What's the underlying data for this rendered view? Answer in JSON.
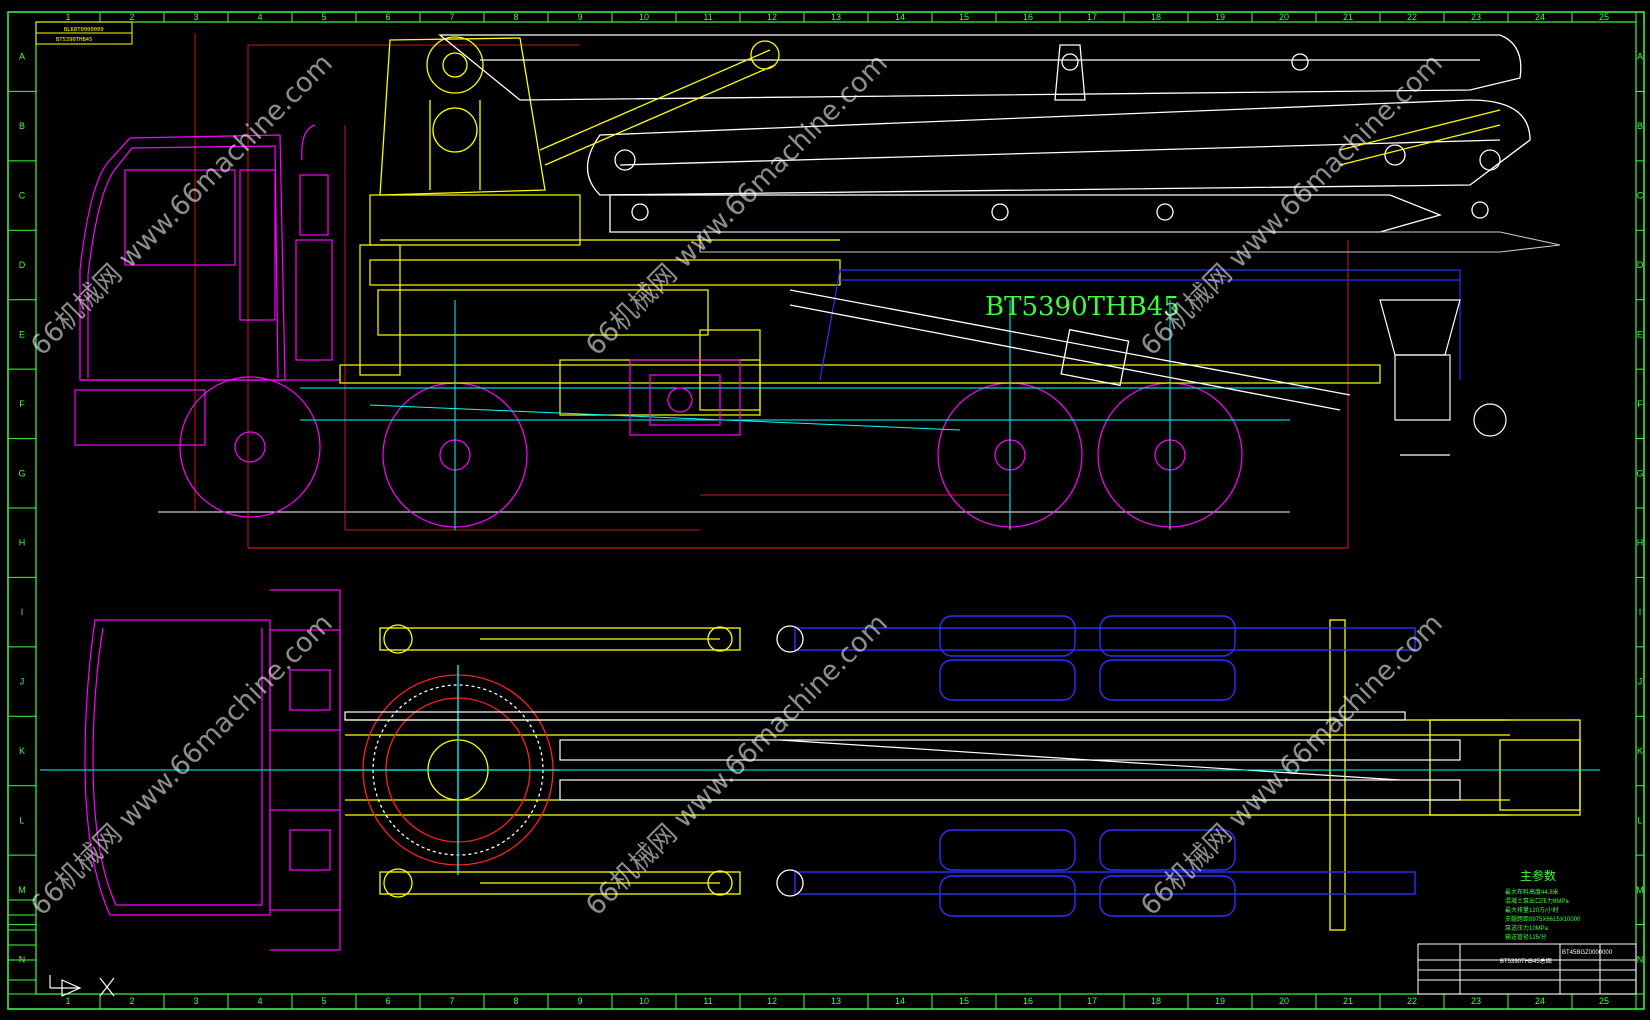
{
  "drawing": {
    "model_label": "BT5390THB45",
    "params_heading": "主参数",
    "params_lines": [
      "最大布料高度44.8米",
      "混凝土泵出口压力8MPa",
      "最大排量120方/小时",
      "支腿跨距8975X8615X10000",
      "泵送压力10MPa",
      "输送管径125/分"
    ],
    "title_block_name": "BT5390THB45总图",
    "title_block_code": "BT45BGZ0000000",
    "tag_top_left_1": "BLK8T0000000",
    "tag_top_left_2": "BT5390THB45",
    "watermark_site": "66机械网 www.66machine.com",
    "column_marks": [
      "1",
      "2",
      "3",
      "4",
      "5",
      "6",
      "7",
      "8",
      "9",
      "10",
      "11",
      "12",
      "13",
      "14",
      "15",
      "16",
      "17",
      "18",
      "19",
      "20",
      "21",
      "22",
      "23",
      "24",
      "25"
    ],
    "row_marks": [
      "A",
      "B",
      "C",
      "D",
      "E",
      "F",
      "G",
      "H",
      "I",
      "J",
      "K",
      "L",
      "M",
      "N"
    ]
  },
  "colors": {
    "frame": "#3cff3c",
    "boom": "#ffffff",
    "chassis": "#ffff00",
    "cab": "#ff00ff",
    "wheels": "#ff00ff",
    "centerline": "#00ffff",
    "outrigger": "#2f2fff",
    "red": "#ff2020"
  }
}
